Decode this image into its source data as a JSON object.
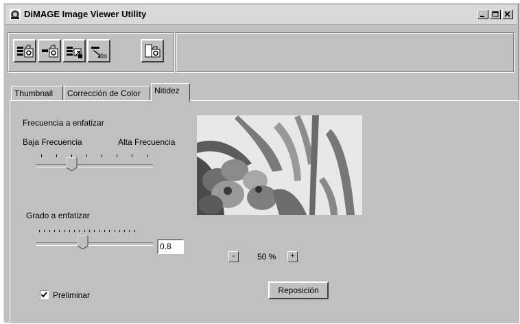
{
  "window": {
    "title": "DiMAGE Image Viewer Utility"
  },
  "title_buttons": {
    "minimize_icon": "minimize-icon",
    "maximize_icon": "maximize-icon",
    "close_icon": "close-icon"
  },
  "toolbar": {
    "buttons": [
      {
        "icon": "camera-transfer-multiple-icon"
      },
      {
        "icon": "camera-transfer-single-icon"
      },
      {
        "icon": "image-rotate-icon"
      },
      {
        "icon": "image-save-icon"
      },
      {
        "icon": "camera-settings-icon"
      }
    ],
    "status_text": ""
  },
  "tabs": [
    {
      "label": "Thumbnail",
      "active": false
    },
    {
      "label": "Corrección de Color",
      "active": false
    },
    {
      "label": "Nitidez",
      "active": true
    }
  ],
  "frequency": {
    "title": "Frecuencia a enfatizar",
    "low_label": "Baja Frecuencia",
    "high_label": "Alta Frecuencia",
    "tick_count": 8,
    "position": 3
  },
  "degree": {
    "title": "Grado a enfatizar",
    "value": "0.8",
    "level": 0.4
  },
  "zoom": {
    "minus_label": "-",
    "value": "50 %",
    "plus_label": "+"
  },
  "reposition_label": "Reposición",
  "preview_checkbox": {
    "label": "Preliminar",
    "checked": true
  },
  "colors": {
    "face": "#c0c0c0",
    "highlight": "#ffffff",
    "shadow": "#808080",
    "dark_shadow": "#404040"
  }
}
